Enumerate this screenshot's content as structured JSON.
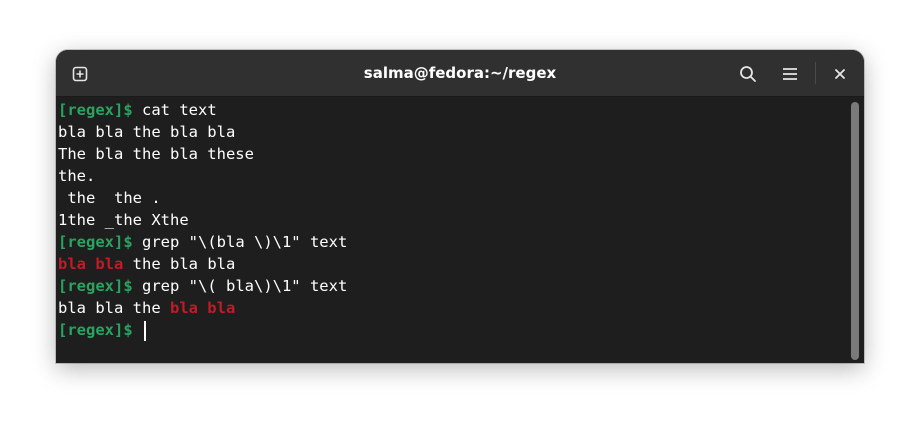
{
  "window": {
    "title": "salma@fedora:~/regex"
  },
  "titlebar_buttons": {
    "new_tab_icon": "new-tab-icon",
    "search_icon": "search-icon",
    "menu_icon": "hamburger-menu-icon",
    "close_label": "×"
  },
  "terminal": {
    "prompt": "[regex]$",
    "lines": [
      {
        "type": "prompt",
        "command": "cat text"
      },
      {
        "type": "output",
        "text": "bla bla the bla bla"
      },
      {
        "type": "output",
        "text": "The bla the bla these"
      },
      {
        "type": "output",
        "text": "the."
      },
      {
        "type": "output",
        "text": " the  the ."
      },
      {
        "type": "output",
        "text": "1the _the Xthe"
      },
      {
        "type": "prompt",
        "command": "grep \"\\(bla \\)\\1\" text"
      },
      {
        "type": "match_line",
        "before": "",
        "match": "bla bla",
        "after": " the bla bla"
      },
      {
        "type": "prompt",
        "command": "grep \"\\( bla\\)\\1\" text"
      },
      {
        "type": "match_line",
        "before": "bla bla the ",
        "match": "bla bla",
        "after": ""
      },
      {
        "type": "prompt_cursor",
        "command": ""
      }
    ]
  },
  "colors": {
    "prompt": "#2aa361",
    "match": "#c01c28",
    "background": "#1e1e1e",
    "titlebar": "#303030"
  }
}
